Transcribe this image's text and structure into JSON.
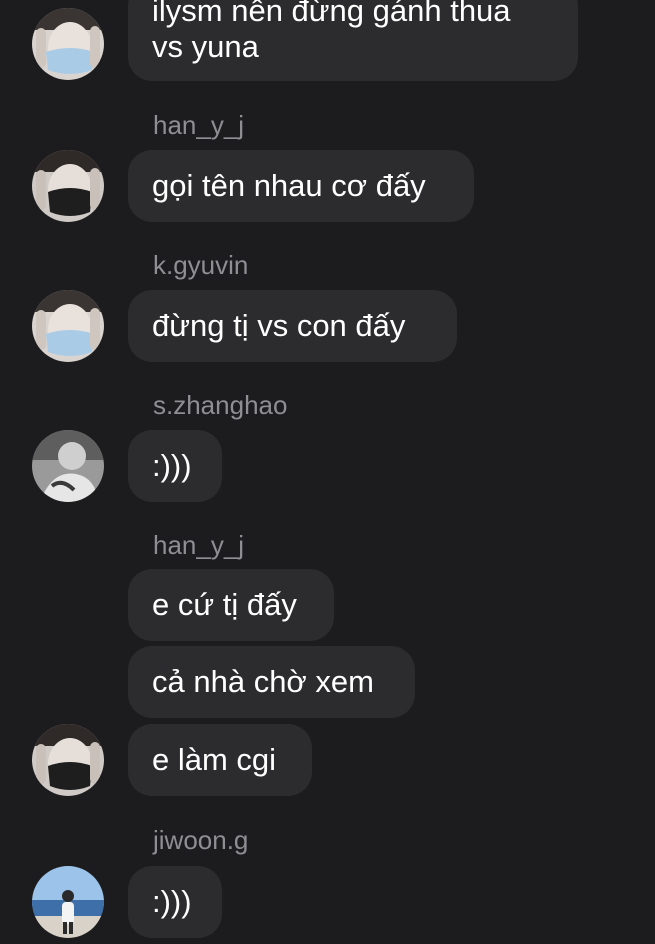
{
  "messages": {
    "m1": {
      "line1": "ilysm nên đừng gánh thua",
      "line2": "vs yuna"
    },
    "m2": {
      "sender": "han_y_j",
      "text": "gọi tên nhau cơ đấy"
    },
    "m3": {
      "sender": "k.gyuvin",
      "text": "đừng tị vs con đấy"
    },
    "m4": {
      "sender": "s.zhanghao",
      "text": ":)))"
    },
    "m5": {
      "sender": "han_y_j",
      "text": "e cứ tị đấy"
    },
    "m6": {
      "text": "cả nhà chờ xem"
    },
    "m7": {
      "text": "e làm cgi"
    },
    "m8": {
      "sender": "jiwoon.g",
      "text": ":)))"
    }
  },
  "avatars": {
    "k_gyuvin": "masked-face-blue-avatar",
    "han_y_j": "masked-face-black-avatar",
    "s_zhanghao": "grayscale-photo-avatar",
    "jiwoon_g": "beach-photo-avatar"
  },
  "colors": {
    "background": "#1c1c1e",
    "bubble": "#2c2c2e",
    "sender": "#8e8e93",
    "text": "#ffffff"
  }
}
